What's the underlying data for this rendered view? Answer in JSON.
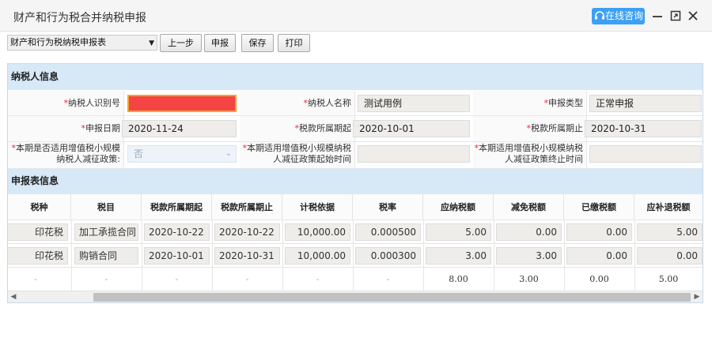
{
  "window": {
    "title": "财产和行为税合并纳税申报",
    "consult_label": "在线咨询"
  },
  "toolbar": {
    "form_select_value": "财产和行为税纳税申报表",
    "prev_label": "上一步",
    "declare_label": "申报",
    "save_label": "保存",
    "print_label": "打印"
  },
  "taxpayer": {
    "section_title": "纳税人信息",
    "id_label": "纳税人识别号",
    "id_value": "",
    "name_label": "纳税人名称",
    "name_value": "测试用例",
    "decl_type_label": "申报类型",
    "decl_type_value": "正常申报",
    "decl_date_label": "申报日期",
    "decl_date_value": "2020-11-24",
    "period_start_label": "税款所属期起",
    "period_start_value": "2020-10-01",
    "period_end_label": "税款所属期止",
    "period_end_value": "2020-10-31",
    "small_scale_label_1": "本期是否适用增值税小规模",
    "small_scale_label_2": "纳税人减征政策:",
    "small_scale_value": "否",
    "policy_start_label_1": "本期适用增值税小规模纳税",
    "policy_start_label_2": "人减征政策起始时间",
    "policy_start_value": "",
    "policy_end_label_1": "本期适用增值税小规模纳税",
    "policy_end_label_2": "人减征政策终止时间",
    "policy_end_value": ""
  },
  "declaration": {
    "section_title": "申报表信息",
    "columns": [
      "税种",
      "税目",
      "税款所属期起",
      "税款所属期止",
      "计税依据",
      "税率",
      "应纳税额",
      "减免税额",
      "已缴税额",
      "应补退税额"
    ],
    "rows": [
      [
        "印花税",
        "加工承揽合同",
        "2020-10-22",
        "2020-10-22",
        "10,000.00",
        "0.000500",
        "5.00",
        "0.00",
        "0.00",
        "5.00"
      ],
      [
        "印花税",
        "购销合同",
        "2020-10-01",
        "2020-10-31",
        "10,000.00",
        "0.000300",
        "3.00",
        "3.00",
        "0.00",
        "0.00"
      ]
    ],
    "totals": [
      "-",
      "-",
      "-",
      "-",
      "-",
      "-",
      "8.00",
      "3.00",
      "0.00",
      "5.00"
    ]
  },
  "colors": {
    "accent": "#3da0f5",
    "section_bg": "#d7e8f7",
    "required": "#e23333",
    "error_field": "#f44444"
  }
}
